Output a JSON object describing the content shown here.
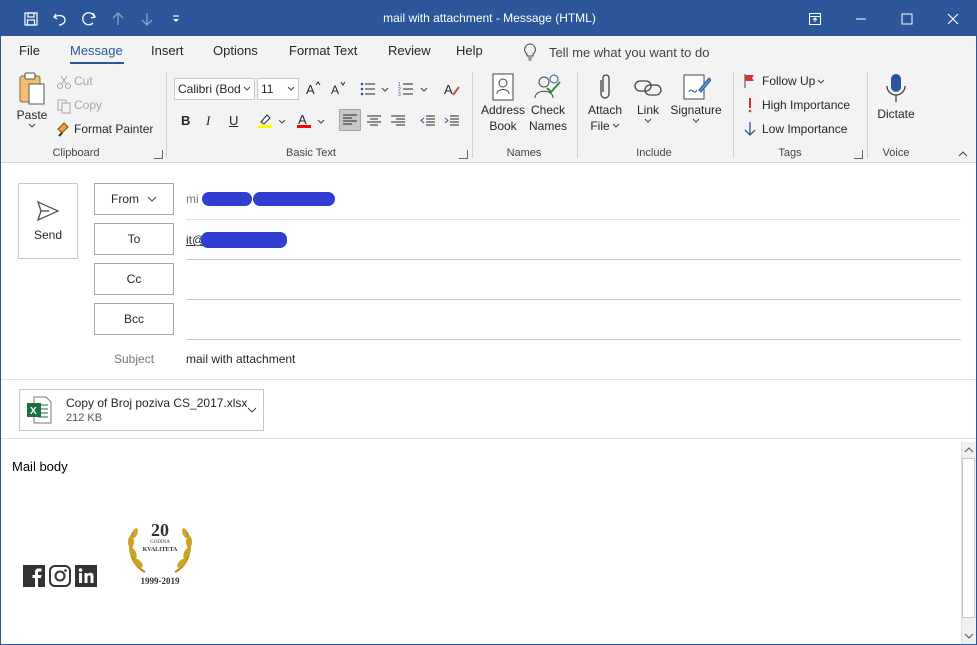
{
  "window": {
    "title": "mail with attachment  -  Message (HTML)"
  },
  "tabs": [
    "File",
    "Message",
    "Insert",
    "Options",
    "Format Text",
    "Review",
    "Help"
  ],
  "tell_me": "Tell me what you want to do",
  "ribbon": {
    "clipboard": {
      "paste": "Paste",
      "cut": "Cut",
      "copy": "Copy",
      "format_painter": "Format Painter",
      "label": "Clipboard"
    },
    "basic_text": {
      "font": "Calibri (Bod",
      "size": "11",
      "bold": "B",
      "italic": "I",
      "underline": "U",
      "label": "Basic Text"
    },
    "names": {
      "address_book_1": "Address",
      "address_book_2": "Book",
      "check_names_1": "Check",
      "check_names_2": "Names",
      "label": "Names"
    },
    "include": {
      "attach_1": "Attach",
      "attach_2": "File",
      "link": "Link",
      "signature": "Signature",
      "label": "Include"
    },
    "tags": {
      "follow_up": "Follow Up",
      "high": "High Importance",
      "low": "Low Importance",
      "label": "Tags"
    },
    "voice": {
      "dictate": "Dictate",
      "label": "Voice"
    }
  },
  "compose": {
    "send": "Send",
    "from_label": "From",
    "from_value": "mi",
    "to_label": "To",
    "to_value": "it@",
    "cc_label": "Cc",
    "bcc_label": "Bcc",
    "subject_label": "Subject",
    "subject_value": "mail with attachment"
  },
  "attachment": {
    "name": "Copy of Broj poziva CS_2017.xlsx",
    "size": "212 KB"
  },
  "body": {
    "text": "Mail body",
    "badge_number": "20",
    "badge_small": "GODINA",
    "badge_word": "KVALITETA",
    "badge_years": "1999-2019"
  },
  "colors": {
    "accent": "#2b579a",
    "redaction": "#2f3fd1",
    "excel": "#1d6f42",
    "highlight": "#ffff00",
    "font_color": "#ff0000",
    "flag": "#d13438"
  }
}
